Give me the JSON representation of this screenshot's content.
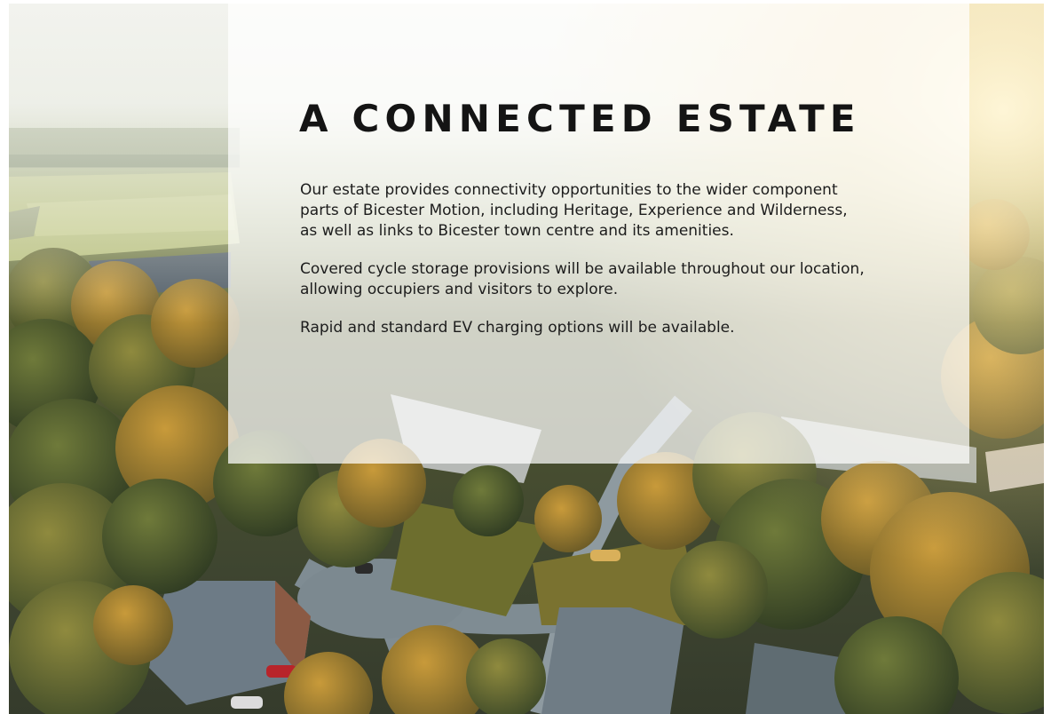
{
  "section": {
    "title": "A CONNECTED ESTATE",
    "paragraphs": [
      "Our estate provides connectivity opportunities to the wider component parts of Bicester Motion, including Heritage, Experience and Wilderness, as well as links to Bicester town centre and its amenities.",
      "Covered cycle storage provisions will be available throughout our location, allowing occupiers and visitors to explore.",
      "Rapid and standard EV charging options will be available."
    ]
  },
  "colors": {
    "card_background": "rgba(255,255,255,0.72)",
    "title_text": "#141414",
    "body_text": "#1c1c1c",
    "sunlight": "#f7e7b2"
  },
  "image": {
    "icon": "aerial-estate-photo"
  }
}
